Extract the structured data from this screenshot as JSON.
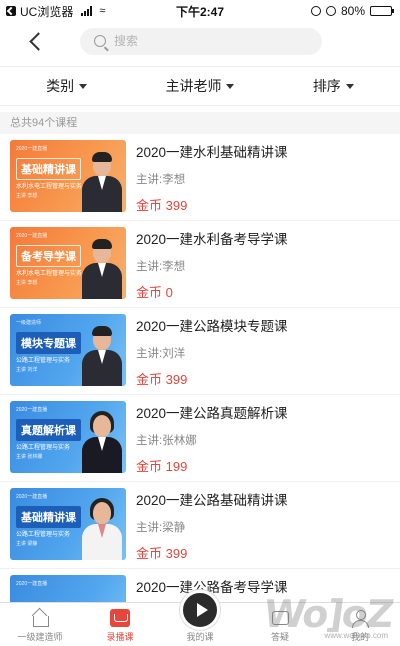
{
  "status_bar": {
    "app_name": "UC浏览器",
    "time": "下午2:47",
    "battery": "80%",
    "battery_level": 0.8
  },
  "nav": {
    "search_placeholder": "搜索"
  },
  "filters": [
    {
      "label": "类别"
    },
    {
      "label": "主讲老师"
    },
    {
      "label": "排序"
    }
  ],
  "total_text": "总共94个课程",
  "courses": [
    {
      "title": "2020一建水利基础精讲课",
      "teacher": "主讲:李想",
      "price": "金币 399",
      "thumb": {
        "tag": "2020一建直播",
        "title": "基础精讲课",
        "subtitle": "水利水电工程管理与实务",
        "lecturer": "主讲 李想"
      }
    },
    {
      "title": "2020一建水利备考导学课",
      "teacher": "主讲:李想",
      "price": "金币 0",
      "thumb": {
        "tag": "2020一建直播",
        "title": "备考导学课",
        "subtitle": "水利水电工程管理与实务",
        "lecturer": "主讲 李想"
      }
    },
    {
      "title": "2020一建公路模块专题课",
      "teacher": "主讲:刘洋",
      "price": "金币 399",
      "thumb": {
        "tag": "一级建造师",
        "title": "模块专题课",
        "subtitle": "公路工程管理与实务",
        "lecturer": "主讲 刘洋"
      }
    },
    {
      "title": "2020一建公路真题解析课",
      "teacher": "主讲:张林娜",
      "price": "金币 199",
      "thumb": {
        "tag": "2020一建直播",
        "title": "真题解析课",
        "subtitle": "公路工程管理与实务",
        "lecturer": "主讲 张林娜"
      }
    },
    {
      "title": "2020一建公路基础精讲课",
      "teacher": "主讲:梁静",
      "price": "金币 399",
      "thumb": {
        "tag": "2020一建直播",
        "title": "基础精讲课",
        "subtitle": "公路工程管理与实务",
        "lecturer": "主讲 梁静"
      }
    },
    {
      "title": "2020一建公路备考导学课",
      "teacher": "",
      "price": "",
      "thumb": {
        "tag": "2020一建直播",
        "title": "",
        "subtitle": "",
        "lecturer": ""
      }
    }
  ],
  "tabs": [
    {
      "label": "一级建造师",
      "icon": "home-icon"
    },
    {
      "label": "录播课",
      "icon": "book-icon",
      "active": true
    },
    {
      "label": "我的课",
      "icon": "play-icon"
    },
    {
      "label": "答疑",
      "icon": "qa-icon"
    },
    {
      "label": "我的",
      "icon": "profile-icon"
    }
  ],
  "watermark": {
    "logo": "Wo]oZ",
    "url": "www.wofowo.com"
  },
  "colors": {
    "price": "#e8453c",
    "active_tab": "#e8453c",
    "thumb_orange": "#f47a3a",
    "thumb_blue": "#3a8be0"
  }
}
